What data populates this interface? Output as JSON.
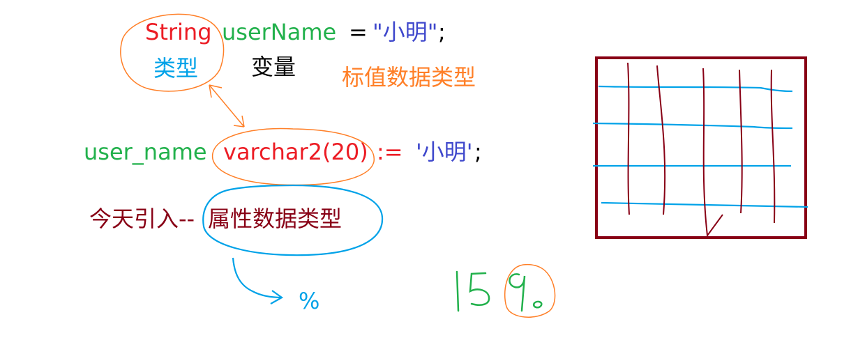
{
  "colors": {
    "red": "#ec1c24",
    "green": "#22b14c",
    "blue": "#3f48cc",
    "cyan": "#00a2e8",
    "black": "#000000",
    "orange": "#ff7f27",
    "maroon": "#880015"
  },
  "line1": {
    "type_word": "String",
    "var_name": "userName",
    "equals": "=",
    "value": "\"小明\"",
    "semicolon": ";"
  },
  "annotations": {
    "type_label": "类型",
    "var_label": "变量",
    "scalar_type": "标值数据类型"
  },
  "line2": {
    "var_name": "user_name",
    "type_word": "varchar2(20)",
    "assign": ":=",
    "value": "'小明'",
    "semicolon": ";"
  },
  "today": {
    "prefix": "今天引入--",
    "attr_type": "属性数据类型"
  },
  "percent": "%",
  "icons": [
    "hand-drawn-circle",
    "double-arrow",
    "curved-arrow",
    "grid-box",
    "handwritten-digits"
  ]
}
